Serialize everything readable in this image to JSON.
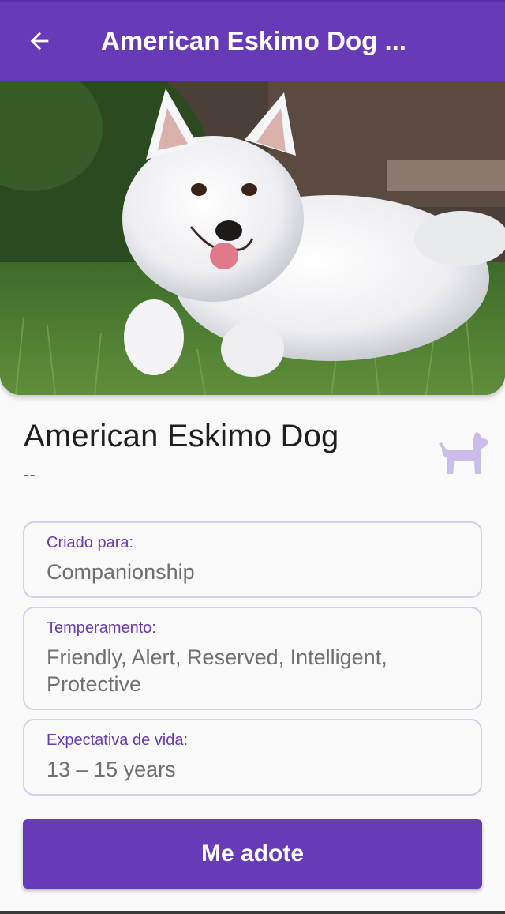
{
  "app_bar": {
    "title": "American Eskimo Dog ...",
    "back_icon": "arrow-left-icon"
  },
  "hero": {
    "icon": "dog-photo"
  },
  "breed": {
    "name": "American Eskimo Dog",
    "subtitle": "--",
    "icon": "dog-icon"
  },
  "details": [
    {
      "label": "Criado para:",
      "value": "Companionship"
    },
    {
      "label": "Temperamento:",
      "value": "Friendly, Alert, Reserved, Intelligent, Protective"
    },
    {
      "label": "Expectativa de vida:",
      "value": "13 – 15 years"
    }
  ],
  "cta": {
    "label": "Me adote"
  },
  "colors": {
    "primary": "#673ab7",
    "card_border": "#d7cdea",
    "icon_tint": "#cbbcec"
  }
}
